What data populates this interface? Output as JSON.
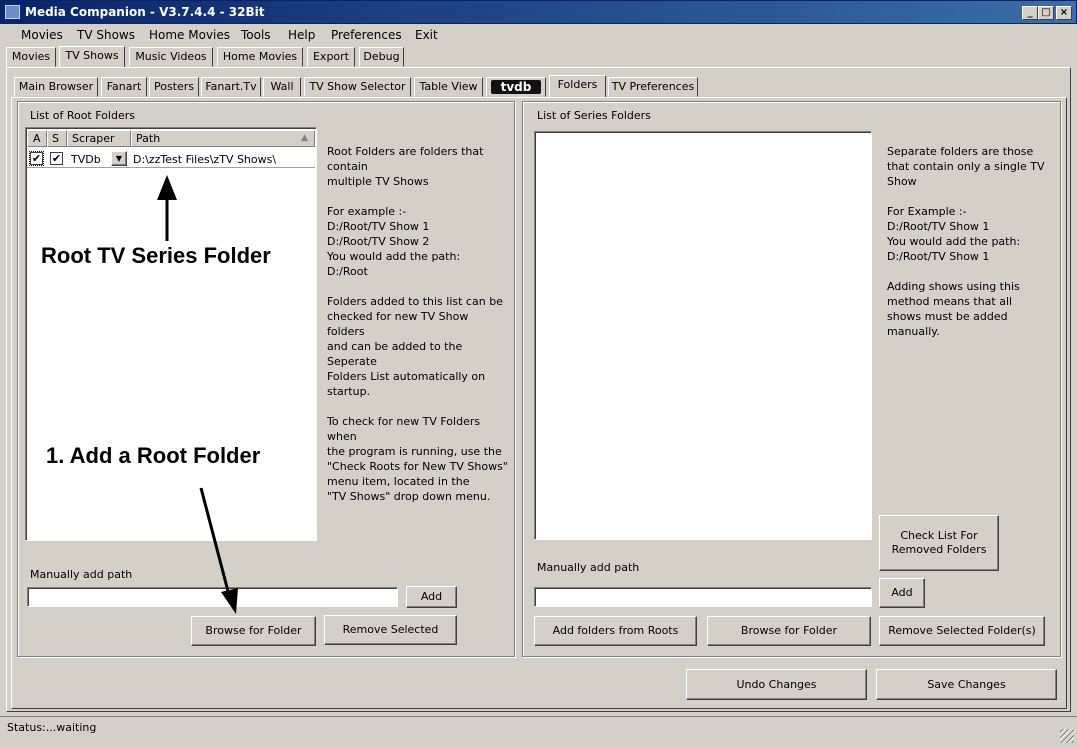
{
  "window": {
    "title": "Media Companion - V3.7.4.4 - 32Bit",
    "buttons": {
      "minimize": "_",
      "maximize": "□",
      "close": "×"
    }
  },
  "menu": [
    "Movies",
    "TV Shows",
    "Home Movies",
    "Tools",
    "Help",
    "Preferences",
    "Exit"
  ],
  "top_tabs": [
    "Movies",
    "TV Shows",
    "Music Videos",
    "Home Movies",
    "Export",
    "Debug"
  ],
  "sub_tabs": [
    "Main Browser",
    "Fanart",
    "Posters",
    "Fanart.Tv",
    "Wall",
    "TV Show Selector",
    "Table View",
    "Folders",
    "TV Preferences"
  ],
  "tvdb_logo": "tvdb",
  "left_panel": {
    "group_title": "List of Root Folders",
    "columns": {
      "a": "A",
      "s": "S",
      "scraper": "Scraper",
      "path": "Path"
    },
    "row": {
      "a_checked": "✔",
      "s_checked": "✔",
      "scraper": "TVDb",
      "path": "D:\\zzTest Files\\zTV Shows\\"
    },
    "description": "Root Folders are folders that\ncontain\nmultiple TV Shows\n\nFor example :-\nD:/Root/TV Show 1\nD:/Root/TV Show 2\nYou would add the path:\nD:/Root\n\nFolders added to this list can be\nchecked for new TV Show\nfolders\nand can be added to the\nSeperate\nFolders List automatically on\nstartup.\n\nTo check for new TV Folders\nwhen\nthe program is running, use the\n\"Check Roots for New TV Shows\"\nmenu item, located in the\n\"TV Shows\" drop down menu.",
    "manual_label": "Manually add path",
    "manual_value": "",
    "add_button": "Add",
    "browse_button": "Browse for Folder",
    "remove_button": "Remove Selected"
  },
  "right_panel": {
    "group_title": "List of Series Folders",
    "description": "Separate folders are those\nthat contain only a single TV\nShow\n\nFor Example :-\nD:/Root/TV Show 1\nYou would add the path:\nD:/Root/TV Show 1\n\nAdding shows using this\nmethod means that all\nshows must be added\nmanually.",
    "check_button": "Check List For\nRemoved Folders",
    "manual_label": "Manually add path",
    "manual_value": "",
    "add_button": "Add",
    "add_from_roots_button": "Add folders from Roots",
    "browse_button": "Browse for Folder",
    "remove_button": "Remove Selected Folder(s)"
  },
  "bottom": {
    "undo_button": "Undo Changes",
    "save_button": "Save Changes"
  },
  "status": "Status:...waiting",
  "annotations": {
    "root_label": "Root TV Series Folder",
    "step1": "1. Add a Root Folder"
  }
}
